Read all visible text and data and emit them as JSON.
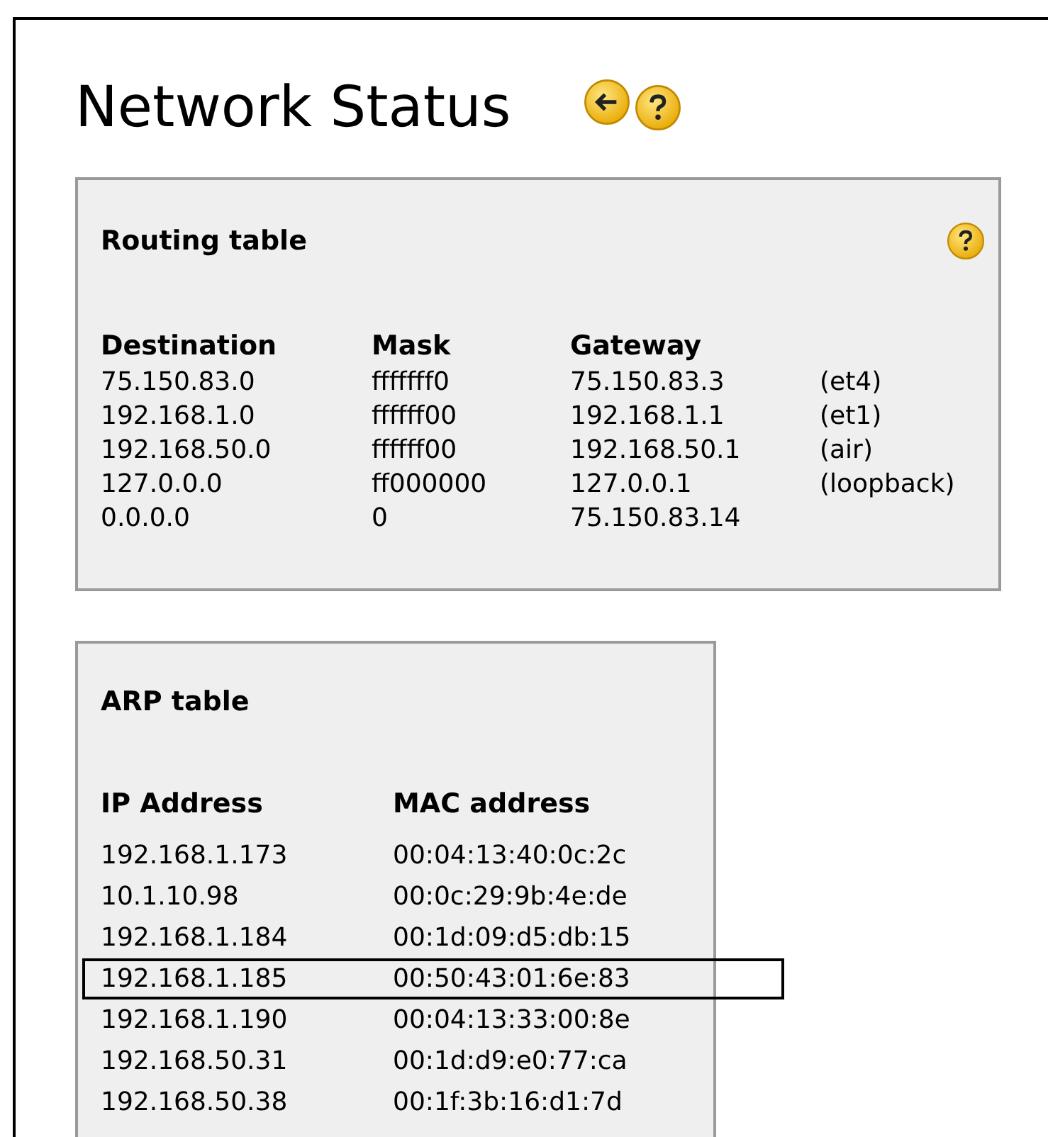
{
  "title": "Network Status",
  "routing_table": {
    "heading": "Routing table",
    "columns": [
      "Destination",
      "Mask",
      "Gateway"
    ],
    "rows": [
      {
        "destination": "75.150.83.0",
        "mask": "fffffff0",
        "gateway": "75.150.83.3",
        "interface": "(et4)"
      },
      {
        "destination": "192.168.1.0",
        "mask": "ffffff00",
        "gateway": "192.168.1.1",
        "interface": "(et1)"
      },
      {
        "destination": "192.168.50.0",
        "mask": "ffffff00",
        "gateway": "192.168.50.1",
        "interface": "(air)"
      },
      {
        "destination": "127.0.0.0",
        "mask": "ff000000",
        "gateway": "127.0.0.1",
        "interface": "(loopback)"
      },
      {
        "destination": "0.0.0.0",
        "mask": "0",
        "gateway": "75.150.83.14"
      }
    ]
  },
  "arp_table": {
    "heading": "ARP table",
    "columns": [
      "IP Address",
      "MAC address"
    ],
    "rows": [
      {
        "ip": "192.168.1.173",
        "mac": "00:04:13:40:0c:2c",
        "highlighted": false
      },
      {
        "ip": "10.1.10.98",
        "mac": "00:0c:29:9b:4e:de",
        "highlighted": false
      },
      {
        "ip": "192.168.1.184",
        "mac": "00:1d:09:d5:db:15",
        "highlighted": false
      },
      {
        "ip": "192.168.1.185",
        "mac": "00:50:43:01:6e:83",
        "highlighted": true
      },
      {
        "ip": "192.168.1.190",
        "mac": "00:04:13:33:00:8e",
        "highlighted": false
      },
      {
        "ip": "192.168.50.31",
        "mac": "00:1d:d9:e0:77:ca",
        "highlighted": false
      },
      {
        "ip": "192.168.50.38",
        "mac": "00:1f:3b:16:d1:7d",
        "highlighted": false
      }
    ]
  }
}
